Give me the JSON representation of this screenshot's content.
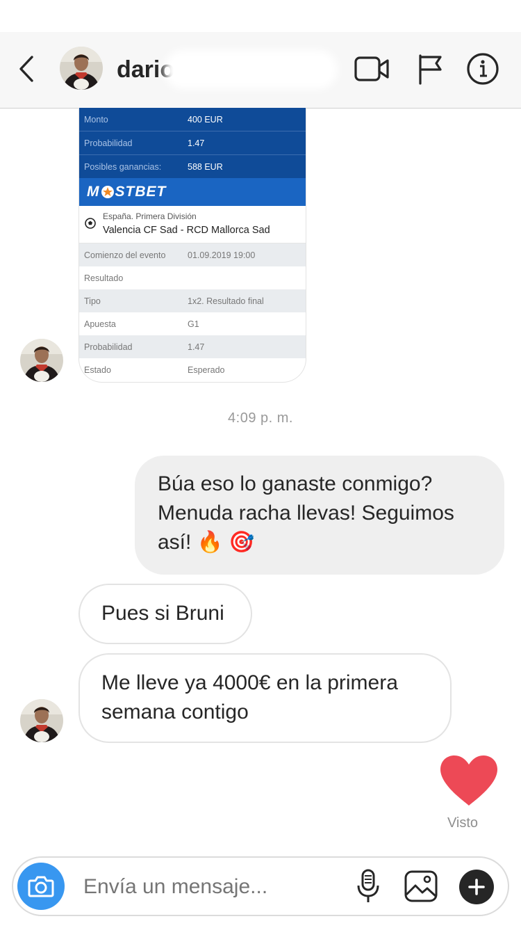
{
  "header": {
    "username": "dario",
    "back_icon": "chevron-left-icon",
    "video_icon": "video-call-icon",
    "flag_icon": "flag-icon",
    "info_icon": "info-icon"
  },
  "bet_card": {
    "summary_rows": [
      {
        "key": "Monto",
        "value": "400 EUR"
      },
      {
        "key": "Probabilidad",
        "value": "1.47"
      },
      {
        "key": "Posibles ganancias:",
        "value": "588 EUR"
      }
    ],
    "brand_pre": "M",
    "brand_post": "STBET",
    "league": "España. Primera División",
    "teams": "Valencia CF Sad - RCD Mallorca Sad",
    "detail_rows": [
      {
        "key": "Comienzo del evento",
        "value": "01.09.2019 19:00"
      },
      {
        "key": "Resultado",
        "value": ""
      },
      {
        "key": "Tipo",
        "value": "1x2. Resultado final"
      },
      {
        "key": "Apuesta",
        "value": "G1"
      },
      {
        "key": "Probabilidad",
        "value": "1.47"
      },
      {
        "key": "Estado",
        "value": "Esperado"
      }
    ]
  },
  "timestamp": "4:09 p. m.",
  "messages": {
    "outgoing_1": "Búa eso lo ganaste conmigo? Menuda racha llevas! Seguimos así! 🔥 🎯",
    "incoming_1": "Pues si Bruni",
    "incoming_2": "Me lleve ya 4000€ en la primera semana contigo"
  },
  "reaction": {
    "icon": "heart-icon",
    "color": "#ed4956"
  },
  "seen_label": "Visto",
  "composer": {
    "placeholder": "Envía un mensaje...",
    "camera_icon": "camera-icon",
    "mic_icon": "microphone-icon",
    "gallery_icon": "gallery-icon",
    "plus_icon": "plus-icon"
  },
  "colors": {
    "camera_button": "#3897f0",
    "bet_header": "#0f4b98",
    "brand_bar": "#1a65c2"
  }
}
